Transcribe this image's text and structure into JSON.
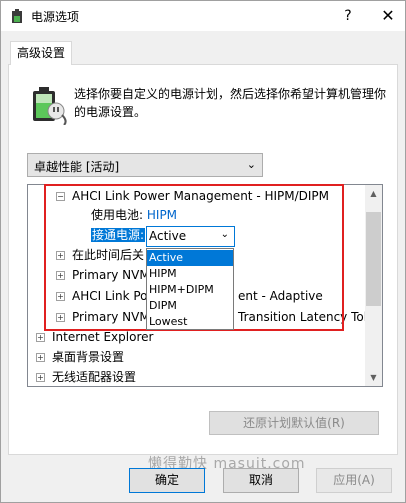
{
  "window": {
    "title": "电源选项",
    "help_glyph": "?",
    "close_glyph": "✕"
  },
  "tabs": [
    {
      "label": "高级设置"
    }
  ],
  "description": "选择你要自定义的电源计划，然后选择你希望计算机管理你的电源设置。",
  "plan_select": {
    "value": "卓越性能 [活动]",
    "chevron": "⌄"
  },
  "tree": {
    "header_item": "AHCI Link Power Management - HIPM/DIPM",
    "on_battery": {
      "label": "使用电池:",
      "value": "HIPM"
    },
    "plugged_in": {
      "label": "接通电源:"
    },
    "rows": [
      {
        "label": "在此时间后关",
        "expander": "+"
      },
      {
        "label": "Primary NVM",
        "expander": "+"
      },
      {
        "label": "AHCI Link Pow",
        "suffix": "ent - Adaptive",
        "expander": "+"
      },
      {
        "label": "Primary NVM",
        "suffix": "Transition Latency Tol",
        "expander": "+"
      },
      {
        "label": "Internet Explorer",
        "expander": "+"
      },
      {
        "label": "桌面背景设置",
        "expander": "+"
      },
      {
        "label": "无线适配器设置",
        "expander": "+"
      }
    ],
    "collapse_glyph": "−"
  },
  "combo": {
    "value": "Active",
    "chevron": "⌄"
  },
  "dropdown_options": [
    "Active",
    "HIPM",
    "HIPM+DIPM",
    "DIPM",
    "Lowest"
  ],
  "buttons": {
    "restore": "还原计划默认值(R)",
    "ok": "确定",
    "cancel": "取消",
    "apply": "应用(A)"
  },
  "watermark": "懒得勤快 masuit.com",
  "icons": {
    "app": "power-options-icon",
    "battery": "battery-plug-icon"
  },
  "colors": {
    "accent": "#0078d7",
    "highlight_border": "#e02020",
    "link": "#0066cc"
  }
}
